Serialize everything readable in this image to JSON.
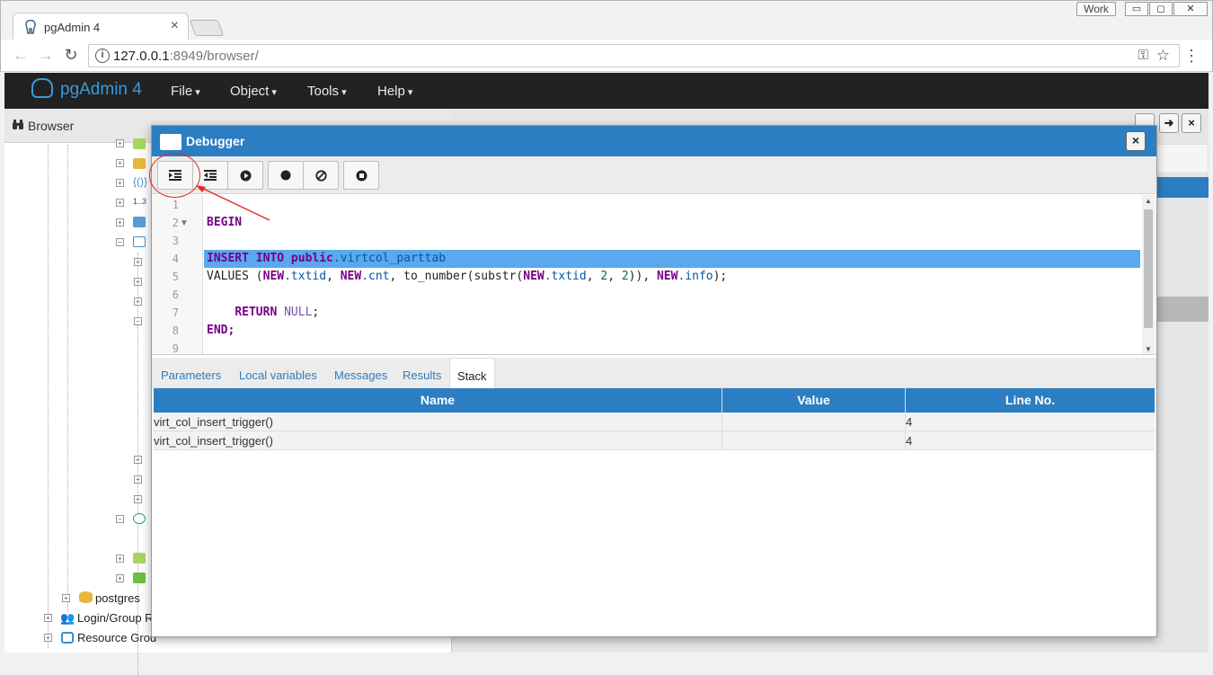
{
  "browser_window": {
    "tab_title": "pgAdmin 4",
    "profile_label": "Work",
    "window_controls": {
      "minimize": "▭",
      "restore": "◻",
      "close": "✕"
    },
    "url_host": "127.0.0.1",
    "url_rest": ":8949/browser/"
  },
  "navbar": {
    "brand": "pgAdmin 4",
    "menus": [
      "File",
      "Object",
      "Tools",
      "Help"
    ]
  },
  "browser_panel": {
    "title": "Browser",
    "tree": [
      {
        "label": "postgres"
      },
      {
        "label": "Login/Group R"
      },
      {
        "label": "Resource Grou"
      }
    ],
    "small_label": "1..3"
  },
  "debugger": {
    "title": "Debugger",
    "toolbar": {
      "step_into_icon": "step-into-icon",
      "step_over_icon": "step-over-icon",
      "continue_icon": "continue-icon",
      "toggle_breakpoint_icon": "breakpoint-icon",
      "clear_breakpoints_icon": "clear-breakpoints-icon",
      "stop_icon": "stop-icon"
    },
    "code": {
      "line_numbers": [
        "1",
        "2",
        "3",
        "4",
        "5",
        "6",
        "7",
        "8",
        "9"
      ],
      "highlighted_line": 4,
      "lines": {
        "l2": "BEGIN",
        "l4_kw1": "INSERT INTO ",
        "l4_kw2": "public",
        "l4_rest": ".virtcol_parttab",
        "l5_a": "VALUES (",
        "l5_new1": "NEW",
        "l5_b": ".txtid",
        "l5_c": ", ",
        "l5_new2": "NEW",
        "l5_d": ".cnt",
        "l5_e": ", to_number(substr(",
        "l5_new3": "NEW",
        "l5_f": ".txtid",
        "l5_g": ", ",
        "l5_n1": "2",
        "l5_h": ", ",
        "l5_n2": "2",
        "l5_i": ")), ",
        "l5_new4": "NEW",
        "l5_j": ".info",
        "l5_k": ");",
        "l7_kw": "RETURN ",
        "l7_null": "NULL",
        "l7_end": ";",
        "l8": "END;"
      }
    },
    "panel_tabs": [
      "Parameters",
      "Local variables",
      "Messages",
      "Results",
      "Stack"
    ],
    "active_tab": "Stack",
    "stack": {
      "columns": [
        "Name",
        "Value",
        "Line No."
      ],
      "rows": [
        {
          "name": "virt_col_insert_trigger()",
          "value": "",
          "line": "4"
        },
        {
          "name": "virt_col_insert_trigger()",
          "value": "",
          "line": "4"
        }
      ]
    }
  },
  "colors": {
    "accent": "#2b7ec1",
    "highlight_line": "#5aa8ed",
    "annotation": "#e0271f",
    "navbar": "#222222"
  }
}
